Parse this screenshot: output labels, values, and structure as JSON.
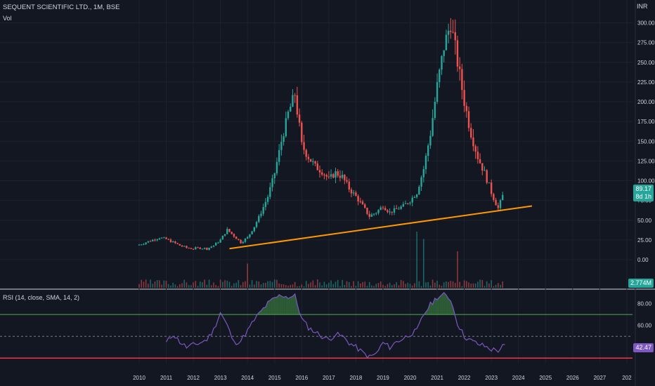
{
  "header": {
    "symbol_title": "SEQUENT SCIENTIFIC LTD., 1M, BSE",
    "volume_label": "Vol",
    "currency": "INR"
  },
  "rsi_panel": {
    "legend": "RSI (14, close, SMA, 14, 2)",
    "value_tag": "42.47"
  },
  "price_tag": {
    "line1": "89.17",
    "line2": "8d 1h"
  },
  "volume_tag": "2.774M",
  "colors": {
    "up": "#26a69a",
    "down": "#ef5350",
    "trendline": "#ff9800",
    "rsi": "#7e57c2",
    "rsi_upper_band": "#4caf50",
    "rsi_lower_band": "#f23645",
    "background": "#131722"
  },
  "chart_data": [
    {
      "type": "candlestick",
      "title": "SEQUENT SCIENTIFIC LTD., 1M, BSE",
      "y_ticks": [
        "300.00",
        "275.00",
        "250.00",
        "225.00",
        "200.00",
        "175.00",
        "150.00",
        "125.00",
        "100.00",
        "75.00",
        "50.00",
        "25.00",
        "0.00"
      ],
      "x_ticks": [
        "2010",
        "2011",
        "2012",
        "2013",
        "2014",
        "2015",
        "2016",
        "2017",
        "2018",
        "2019",
        "2020",
        "2021",
        "2022",
        "2023",
        "2024",
        "2025",
        "2026",
        "2027",
        "202"
      ],
      "ylim": [
        0,
        320
      ],
      "grid": true,
      "series": [
        {
          "name": "close",
          "points": [
            [
              "2010-01",
              19
            ],
            [
              "2010-04",
              22
            ],
            [
              "2010-07",
              25
            ],
            [
              "2010-10",
              28
            ],
            [
              "2011-01",
              26
            ],
            [
              "2011-04",
              22
            ],
            [
              "2011-07",
              18
            ],
            [
              "2011-10",
              15
            ],
            [
              "2012-01",
              14
            ],
            [
              "2012-04",
              15
            ],
            [
              "2012-07",
              14
            ],
            [
              "2012-10",
              18
            ],
            [
              "2013-01",
              25
            ],
            [
              "2013-04",
              38
            ],
            [
              "2013-07",
              30
            ],
            [
              "2013-10",
              22
            ],
            [
              "2014-01",
              28
            ],
            [
              "2014-04",
              42
            ],
            [
              "2014-07",
              60
            ],
            [
              "2014-10",
              80
            ],
            [
              "2015-01",
              110
            ],
            [
              "2015-04",
              150
            ],
            [
              "2015-07",
              185
            ],
            [
              "2015-10",
              210
            ],
            [
              "2016-01",
              145
            ],
            [
              "2016-04",
              130
            ],
            [
              "2016-07",
              118
            ],
            [
              "2016-10",
              112
            ],
            [
              "2017-01",
              102
            ],
            [
              "2017-04",
              110
            ],
            [
              "2017-07",
              105
            ],
            [
              "2017-10",
              90
            ],
            [
              "2018-01",
              80
            ],
            [
              "2018-04",
              68
            ],
            [
              "2018-07",
              55
            ],
            [
              "2018-10",
              60
            ],
            [
              "2019-01",
              68
            ],
            [
              "2019-04",
              60
            ],
            [
              "2019-07",
              64
            ],
            [
              "2019-10",
              68
            ],
            [
              "2020-01",
              75
            ],
            [
              "2020-04",
              85
            ],
            [
              "2020-07",
              115
            ],
            [
              "2020-10",
              160
            ],
            [
              "2021-01",
              220
            ],
            [
              "2021-04",
              270
            ],
            [
              "2021-07",
              300
            ],
            [
              "2021-10",
              250
            ],
            [
              "2022-01",
              200
            ],
            [
              "2022-04",
              160
            ],
            [
              "2022-07",
              130
            ],
            [
              "2022-10",
              110
            ],
            [
              "2023-01",
              85
            ],
            [
              "2023-04",
              65
            ],
            [
              "2023-07",
              89.17
            ]
          ]
        }
      ],
      "trendline": {
        "from": [
          "2013-05",
          14
        ],
        "to": [
          "2024-07",
          68
        ]
      }
    },
    {
      "type": "bar",
      "title": "Vol",
      "last_value": "2.774M",
      "spikes": [
        [
          "2014-01",
          0.35
        ],
        [
          "2020-04",
          1.0
        ],
        [
          "2020-07",
          0.85
        ],
        [
          "2021-10",
          0.6
        ]
      ]
    },
    {
      "type": "line",
      "title": "RSI (14, close, SMA, 14, 2)",
      "y_ticks": [
        "80.00",
        "60.00"
      ],
      "bands": {
        "upper": 70,
        "middle": 50,
        "lower": 30
      },
      "ylim": [
        25,
        92
      ],
      "series": [
        {
          "name": "RSI",
          "points": [
            [
              "2011-01",
              44
            ],
            [
              "2011-04",
              52
            ],
            [
              "2011-07",
              45
            ],
            [
              "2011-10",
              40
            ],
            [
              "2012-01",
              42
            ],
            [
              "2012-04",
              44
            ],
            [
              "2012-07",
              47
            ],
            [
              "2012-10",
              56
            ],
            [
              "2013-01",
              72
            ],
            [
              "2013-04",
              60
            ],
            [
              "2013-07",
              44
            ],
            [
              "2013-10",
              46
            ],
            [
              "2014-01",
              55
            ],
            [
              "2014-04",
              65
            ],
            [
              "2014-07",
              73
            ],
            [
              "2014-10",
              80
            ],
            [
              "2015-01",
              85
            ],
            [
              "2015-04",
              88
            ],
            [
              "2015-07",
              86
            ],
            [
              "2015-10",
              87
            ],
            [
              "2016-01",
              66
            ],
            [
              "2016-04",
              58
            ],
            [
              "2016-07",
              54
            ],
            [
              "2016-10",
              50
            ],
            [
              "2017-01",
              47
            ],
            [
              "2017-04",
              52
            ],
            [
              "2017-07",
              50
            ],
            [
              "2017-10",
              44
            ],
            [
              "2018-01",
              40
            ],
            [
              "2018-04",
              35
            ],
            [
              "2018-07",
              31
            ],
            [
              "2018-10",
              34
            ],
            [
              "2019-01",
              44
            ],
            [
              "2019-04",
              40
            ],
            [
              "2019-07",
              45
            ],
            [
              "2019-10",
              48
            ],
            [
              "2020-01",
              52
            ],
            [
              "2020-04",
              55
            ],
            [
              "2020-07",
              70
            ],
            [
              "2020-10",
              79
            ],
            [
              "2021-01",
              86
            ],
            [
              "2021-04",
              88
            ],
            [
              "2021-07",
              84
            ],
            [
              "2021-10",
              62
            ],
            [
              "2022-01",
              50
            ],
            [
              "2022-04",
              46
            ],
            [
              "2022-07",
              43
            ],
            [
              "2022-10",
              41
            ],
            [
              "2023-01",
              38
            ],
            [
              "2023-04",
              37
            ],
            [
              "2023-07",
              42.47
            ]
          ]
        }
      ]
    }
  ]
}
